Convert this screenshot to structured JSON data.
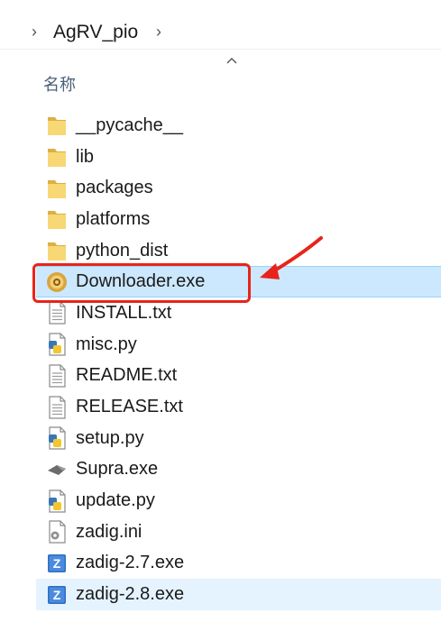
{
  "breadcrumb": {
    "folder": "AgRV_pio"
  },
  "column_header": {
    "name_label": "名称"
  },
  "files": [
    {
      "name": "__pycache__",
      "icon": "folder-icon"
    },
    {
      "name": "lib",
      "icon": "folder-icon"
    },
    {
      "name": "packages",
      "icon": "folder-icon"
    },
    {
      "name": "platforms",
      "icon": "folder-icon"
    },
    {
      "name": "python_dist",
      "icon": "folder-icon"
    },
    {
      "name": "Downloader.exe",
      "icon": "downloader-app-icon"
    },
    {
      "name": "INSTALL.txt",
      "icon": "text-file-icon"
    },
    {
      "name": "misc.py",
      "icon": "python-file-icon"
    },
    {
      "name": "README.txt",
      "icon": "text-file-icon"
    },
    {
      "name": "RELEASE.txt",
      "icon": "text-file-icon"
    },
    {
      "name": "setup.py",
      "icon": "python-file-icon"
    },
    {
      "name": "Supra.exe",
      "icon": "supra-app-icon"
    },
    {
      "name": "update.py",
      "icon": "python-file-icon"
    },
    {
      "name": "zadig.ini",
      "icon": "ini-file-icon"
    },
    {
      "name": "zadig-2.7.exe",
      "icon": "zadig-app-icon"
    },
    {
      "name": "zadig-2.8.exe",
      "icon": "zadig-app-icon"
    }
  ],
  "selection": {
    "selected": "Downloader.exe",
    "hovered": "zadig-2.8.exe"
  },
  "colors": {
    "selection_bg": "#cce8ff",
    "hover_bg": "#e5f3ff",
    "annotation_red": "#e8241a",
    "folder_yellow": "#f8d775"
  }
}
